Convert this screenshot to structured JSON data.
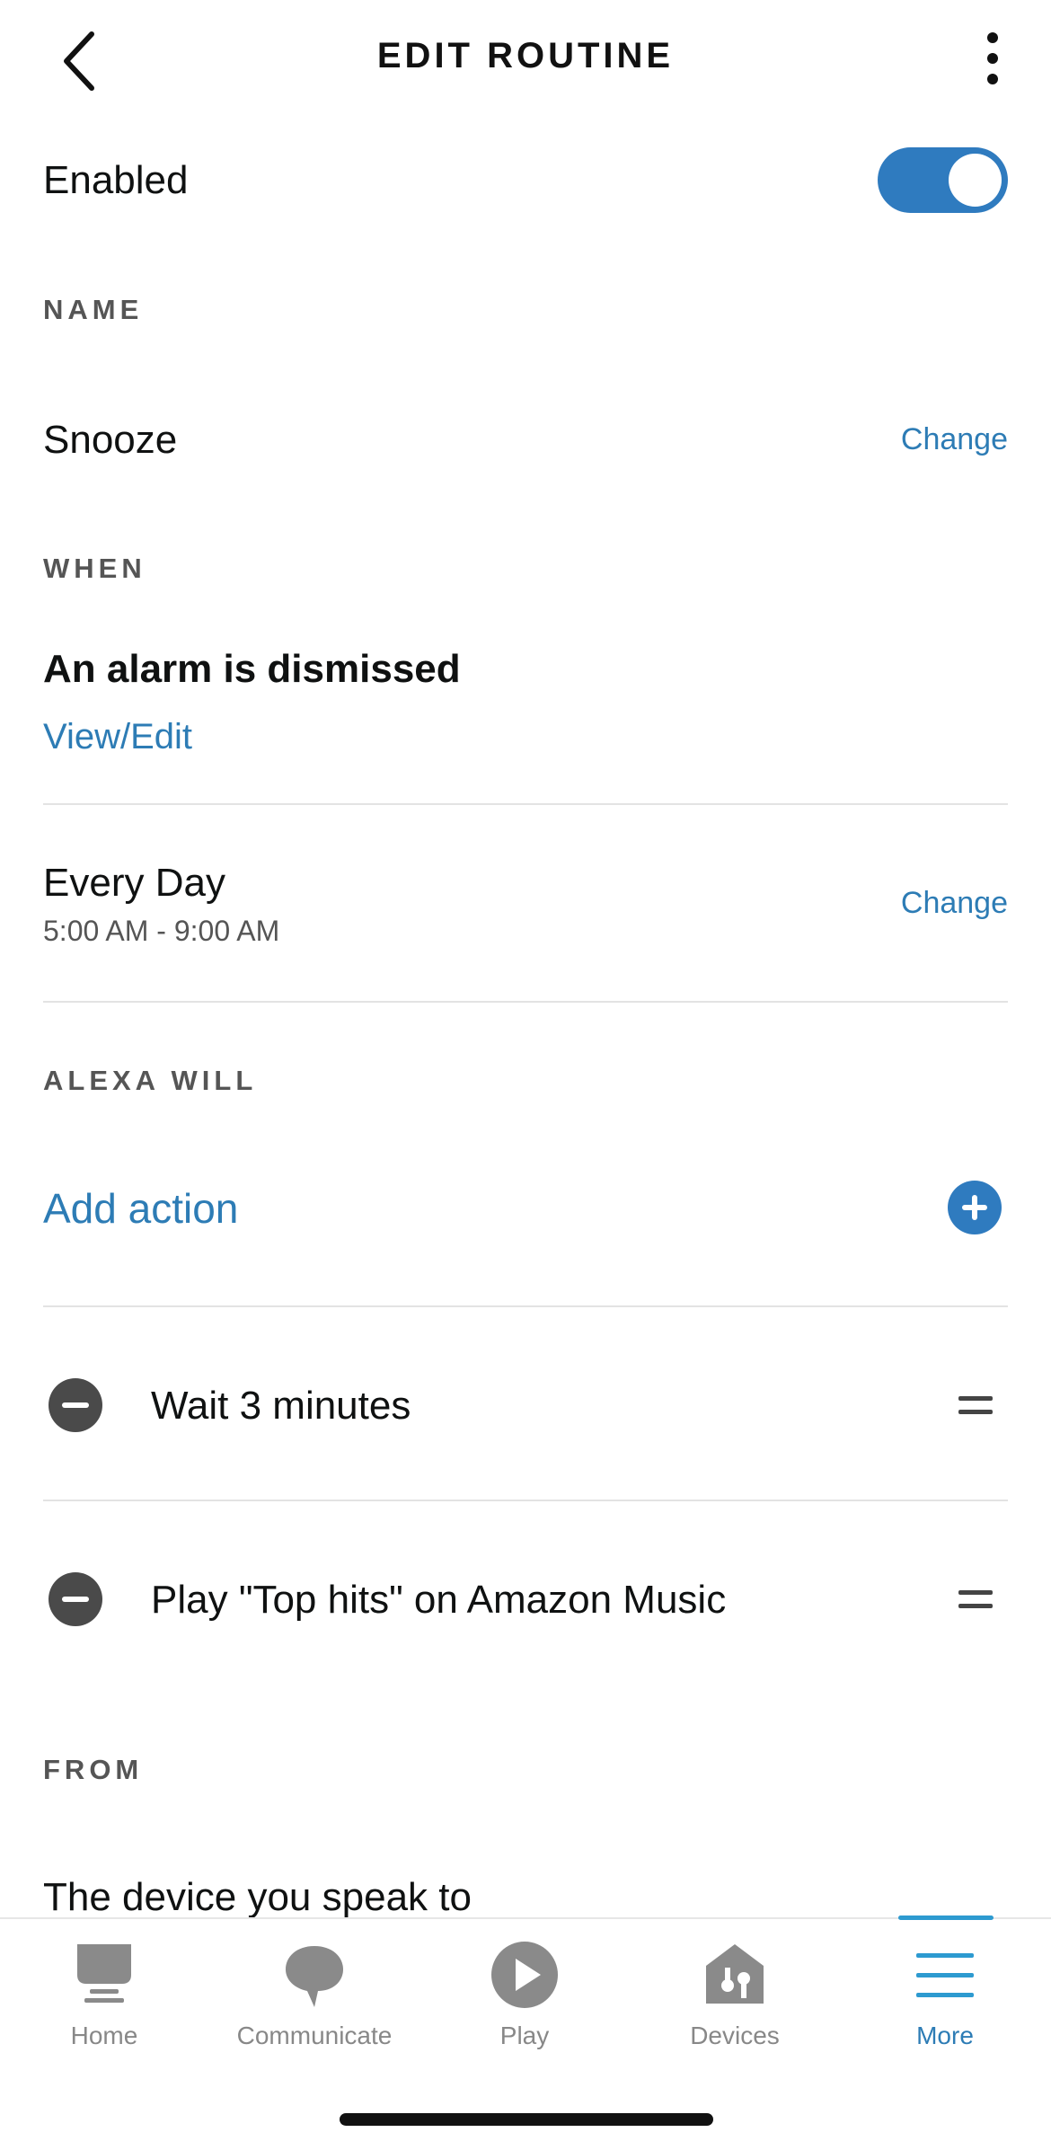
{
  "header": {
    "title": "EDIT ROUTINE"
  },
  "enabled": {
    "label": "Enabled",
    "on": true
  },
  "name_section": {
    "label": "NAME",
    "value": "Snooze",
    "change_label": "Change"
  },
  "when_section": {
    "label": "WHEN",
    "trigger": "An alarm is dismissed",
    "view_edit_label": "View/Edit",
    "schedule": "Every Day",
    "time_range": "5:00 AM - 9:00 AM",
    "change_label": "Change"
  },
  "alexa_will_section": {
    "label": "ALEXA WILL",
    "add_action_label": "Add action",
    "actions": [
      {
        "text": "Wait 3 minutes"
      },
      {
        "text": "Play \"Top hits\" on Amazon Music"
      }
    ]
  },
  "from_section": {
    "label": "FROM",
    "device": "The device you speak to"
  },
  "tabbar": {
    "tabs": [
      {
        "label": "Home",
        "icon": "home-icon"
      },
      {
        "label": "Communicate",
        "icon": "chat-icon"
      },
      {
        "label": "Play",
        "icon": "play-icon"
      },
      {
        "label": "Devices",
        "icon": "devices-icon"
      },
      {
        "label": "More",
        "icon": "menu-icon"
      }
    ],
    "active": "More"
  },
  "colors": {
    "accent": "#2d7cb5",
    "toggle": "#2f7bbf",
    "icon_gray": "#888888"
  }
}
